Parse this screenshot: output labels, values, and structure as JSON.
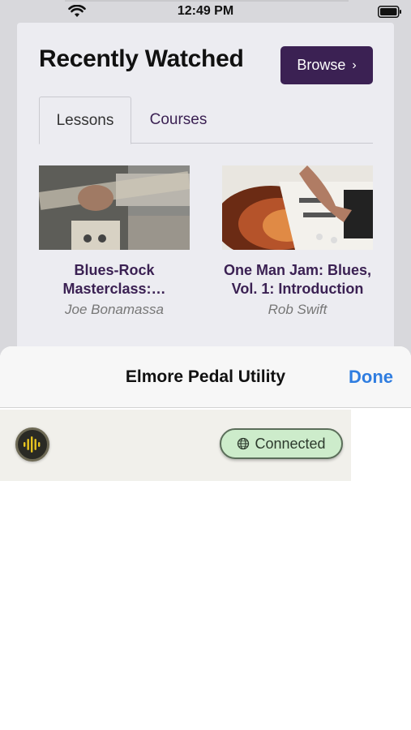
{
  "status_bar": {
    "time": "12:49 PM"
  },
  "background": {
    "title": "Recently Watched",
    "browse_label": "Browse",
    "tabs": [
      {
        "label": "Lessons",
        "active": true
      },
      {
        "label": "Courses",
        "active": false
      }
    ],
    "lessons": [
      {
        "title": "Blues-Rock Masterclass:…",
        "author": "Joe Bonamassa"
      },
      {
        "title": "One Man Jam: Blues, Vol. 1: Introduction",
        "author": "Rob Swift"
      }
    ]
  },
  "sheet": {
    "title": "Elmore Pedal Utility",
    "done_label": "Done",
    "status_label": "Connected"
  },
  "colors": {
    "brand": "#3b2153",
    "link": "#2f7de0",
    "connected_bg": "#cdeccb"
  }
}
